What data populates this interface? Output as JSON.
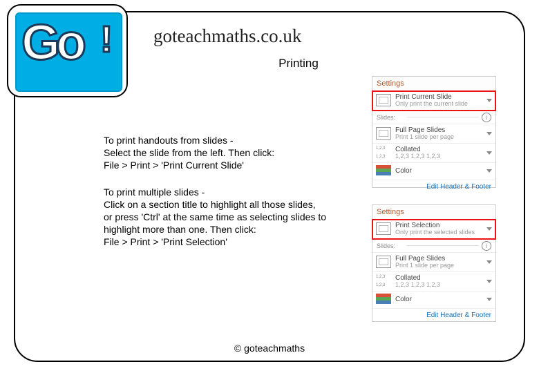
{
  "logo": {
    "text": "Go",
    "bang": "!"
  },
  "header": {
    "site": "goteachmaths.co.uk",
    "title": "Printing"
  },
  "body": {
    "p1_l1": "To print handouts from slides -",
    "p1_l2": "Select the slide from the left. Then click:",
    "p1_l3": "File > Print > 'Print Current Slide'",
    "p2_l1": "To print multiple slides -",
    "p2_l2": "Click on a section title to highlight all those slides,",
    "p2_l3": "or press 'Ctrl' at the same time as selecting slides to",
    "p2_l4": "highlight more than one. Then click:",
    "p2_l5": "File > Print > 'Print Selection'"
  },
  "footer": "© goteachmaths",
  "settings1": {
    "header": "Settings",
    "mode_main": "Print Current Slide",
    "mode_sub": "Only print the current slide",
    "slides_label": "Slides:",
    "info": "i",
    "layout_main": "Full Page Slides",
    "layout_sub": "Print 1 slide per page",
    "collated_main": "Collated",
    "collated_sub": "1,2,3   1,2,3   1,2,3",
    "color": "Color",
    "link": "Edit Header & Footer"
  },
  "settings2": {
    "header": "Settings",
    "mode_main": "Print Selection",
    "mode_sub": "Only print the selected slides",
    "slides_label": "Slides:",
    "info": "i",
    "layout_main": "Full Page Slides",
    "layout_sub": "Print 1 slide per page",
    "collated_main": "Collated",
    "collated_sub": "1,2,3   1,2,3   1,2,3",
    "color": "Color",
    "link": "Edit Header & Footer"
  },
  "colors": {
    "c1": "#d94f3a",
    "c2": "#5aa657",
    "c3": "#4a7fb5"
  }
}
